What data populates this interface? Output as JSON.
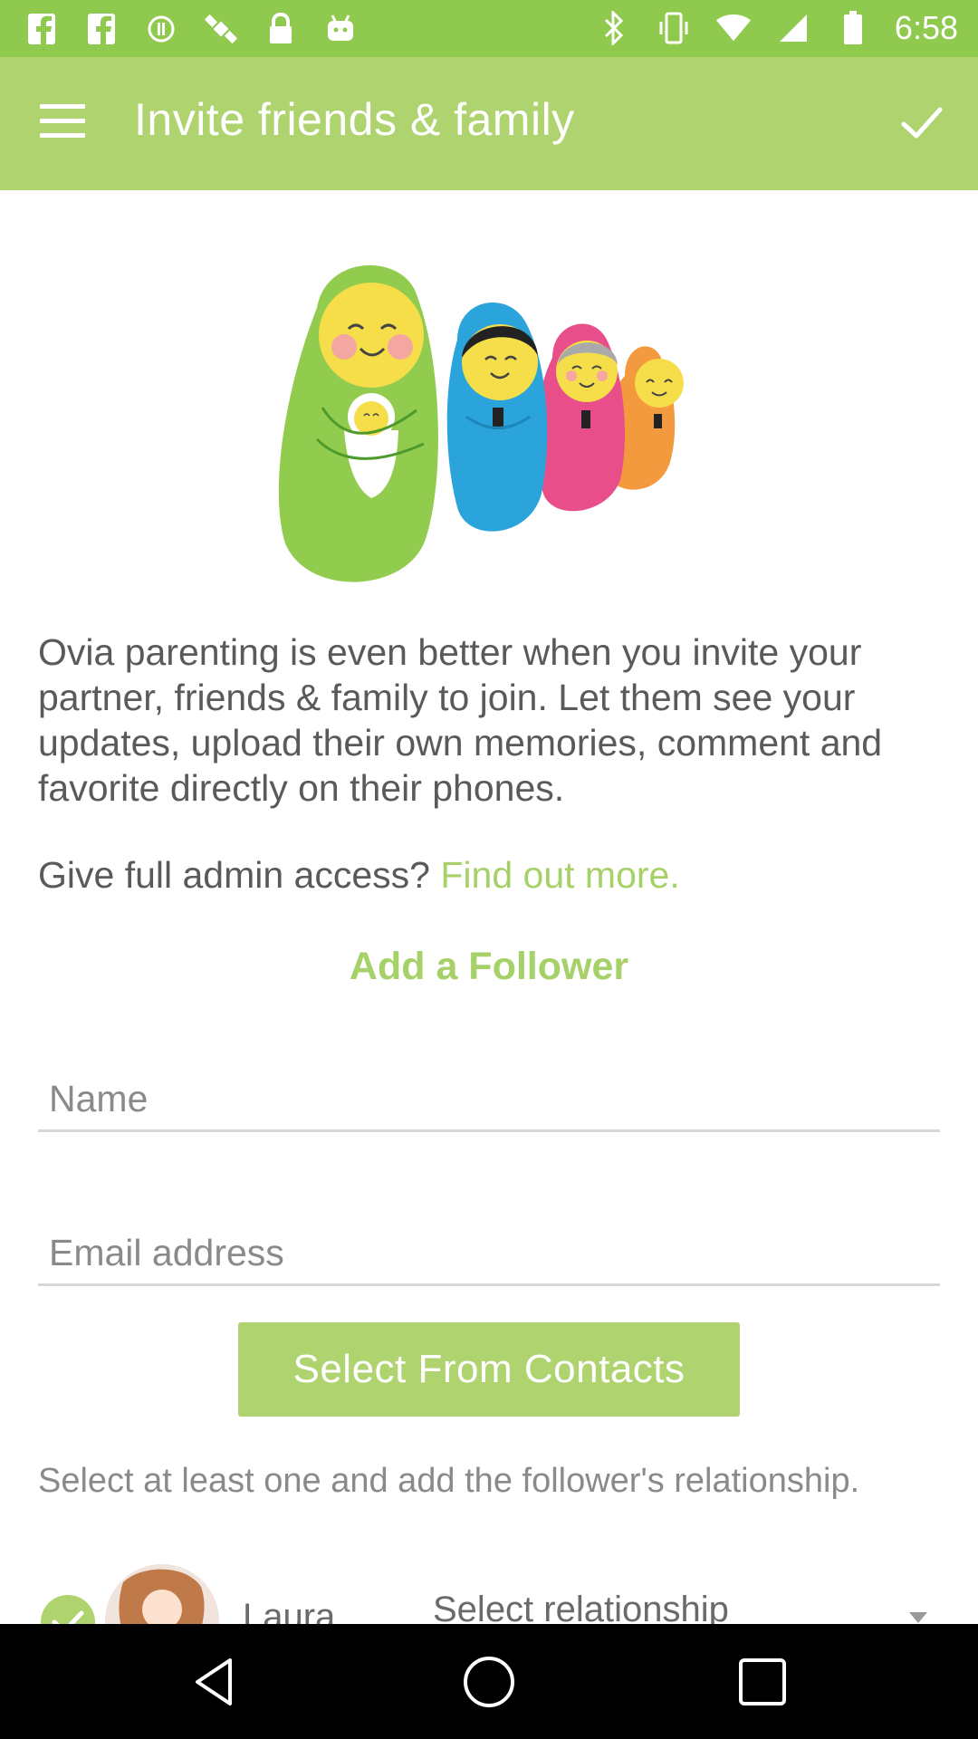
{
  "status_bar": {
    "time": "6:58",
    "left_icons": [
      "facebook-icon",
      "facebook-icon",
      "status-dot-icon",
      "satellite-icon",
      "lock-icon",
      "android-icon"
    ],
    "right_icons": [
      "bluetooth-icon",
      "vibrate-icon",
      "wifi-icon",
      "signal-icon",
      "battery-icon"
    ]
  },
  "app_bar": {
    "title": "Invite friends & family",
    "menu_icon": "hamburger-menu-icon",
    "confirm_icon": "checkmark-icon"
  },
  "content": {
    "intro_text": "Ovia parenting is even better when you invite your partner, friends & family to join. Let them see your updates, upload their own memories, comment and favorite directly on their phones.",
    "admin_question": "Give full admin access?",
    "admin_link": "Find out more.",
    "section_title": "Add a Follower",
    "name_placeholder": "Name",
    "email_placeholder": "Email address",
    "contacts_button": "Select From Contacts",
    "hint_text": "Select at least one and add the follower's relationship."
  },
  "contact_row": {
    "name": "Laura",
    "relationship_placeholder": "Select relationship",
    "checked": true
  },
  "colors": {
    "status_bar": "#8fc94e",
    "app_bar": "#aed36f",
    "accent": "#a6d168",
    "text": "#5a5a5a"
  }
}
